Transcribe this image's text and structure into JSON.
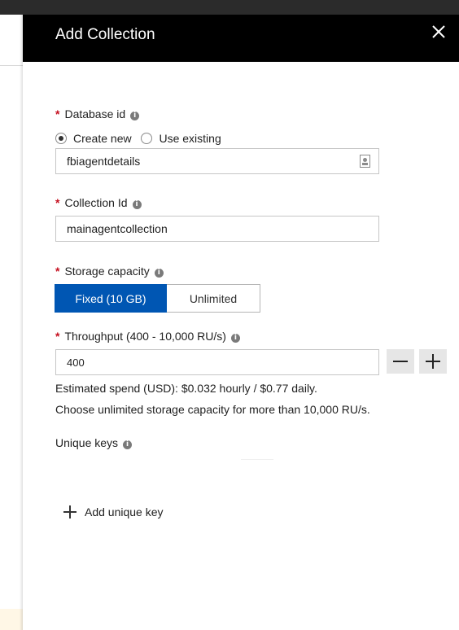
{
  "header": {
    "title": "Add Collection"
  },
  "database_id": {
    "label": "Database id",
    "radio_create": "Create new",
    "radio_existing": "Use existing",
    "value": "fbiagentdetails"
  },
  "collection_id": {
    "label": "Collection Id",
    "value": "mainagentcollection"
  },
  "storage": {
    "label": "Storage capacity",
    "fixed": "Fixed (10 GB)",
    "unlimited": "Unlimited"
  },
  "throughput": {
    "label": "Throughput (400 - 10,000 RU/s)",
    "value": "400",
    "estimate": "Estimated spend (USD): $0.032 hourly / $0.77 daily.",
    "hint": "Choose unlimited storage capacity for more than 10,000 RU/s."
  },
  "unique_keys": {
    "label": "Unique keys",
    "add": "Add unique key"
  },
  "colors": {
    "header": "#000000",
    "accent": "#0056b3",
    "required": "#c50f1f"
  }
}
